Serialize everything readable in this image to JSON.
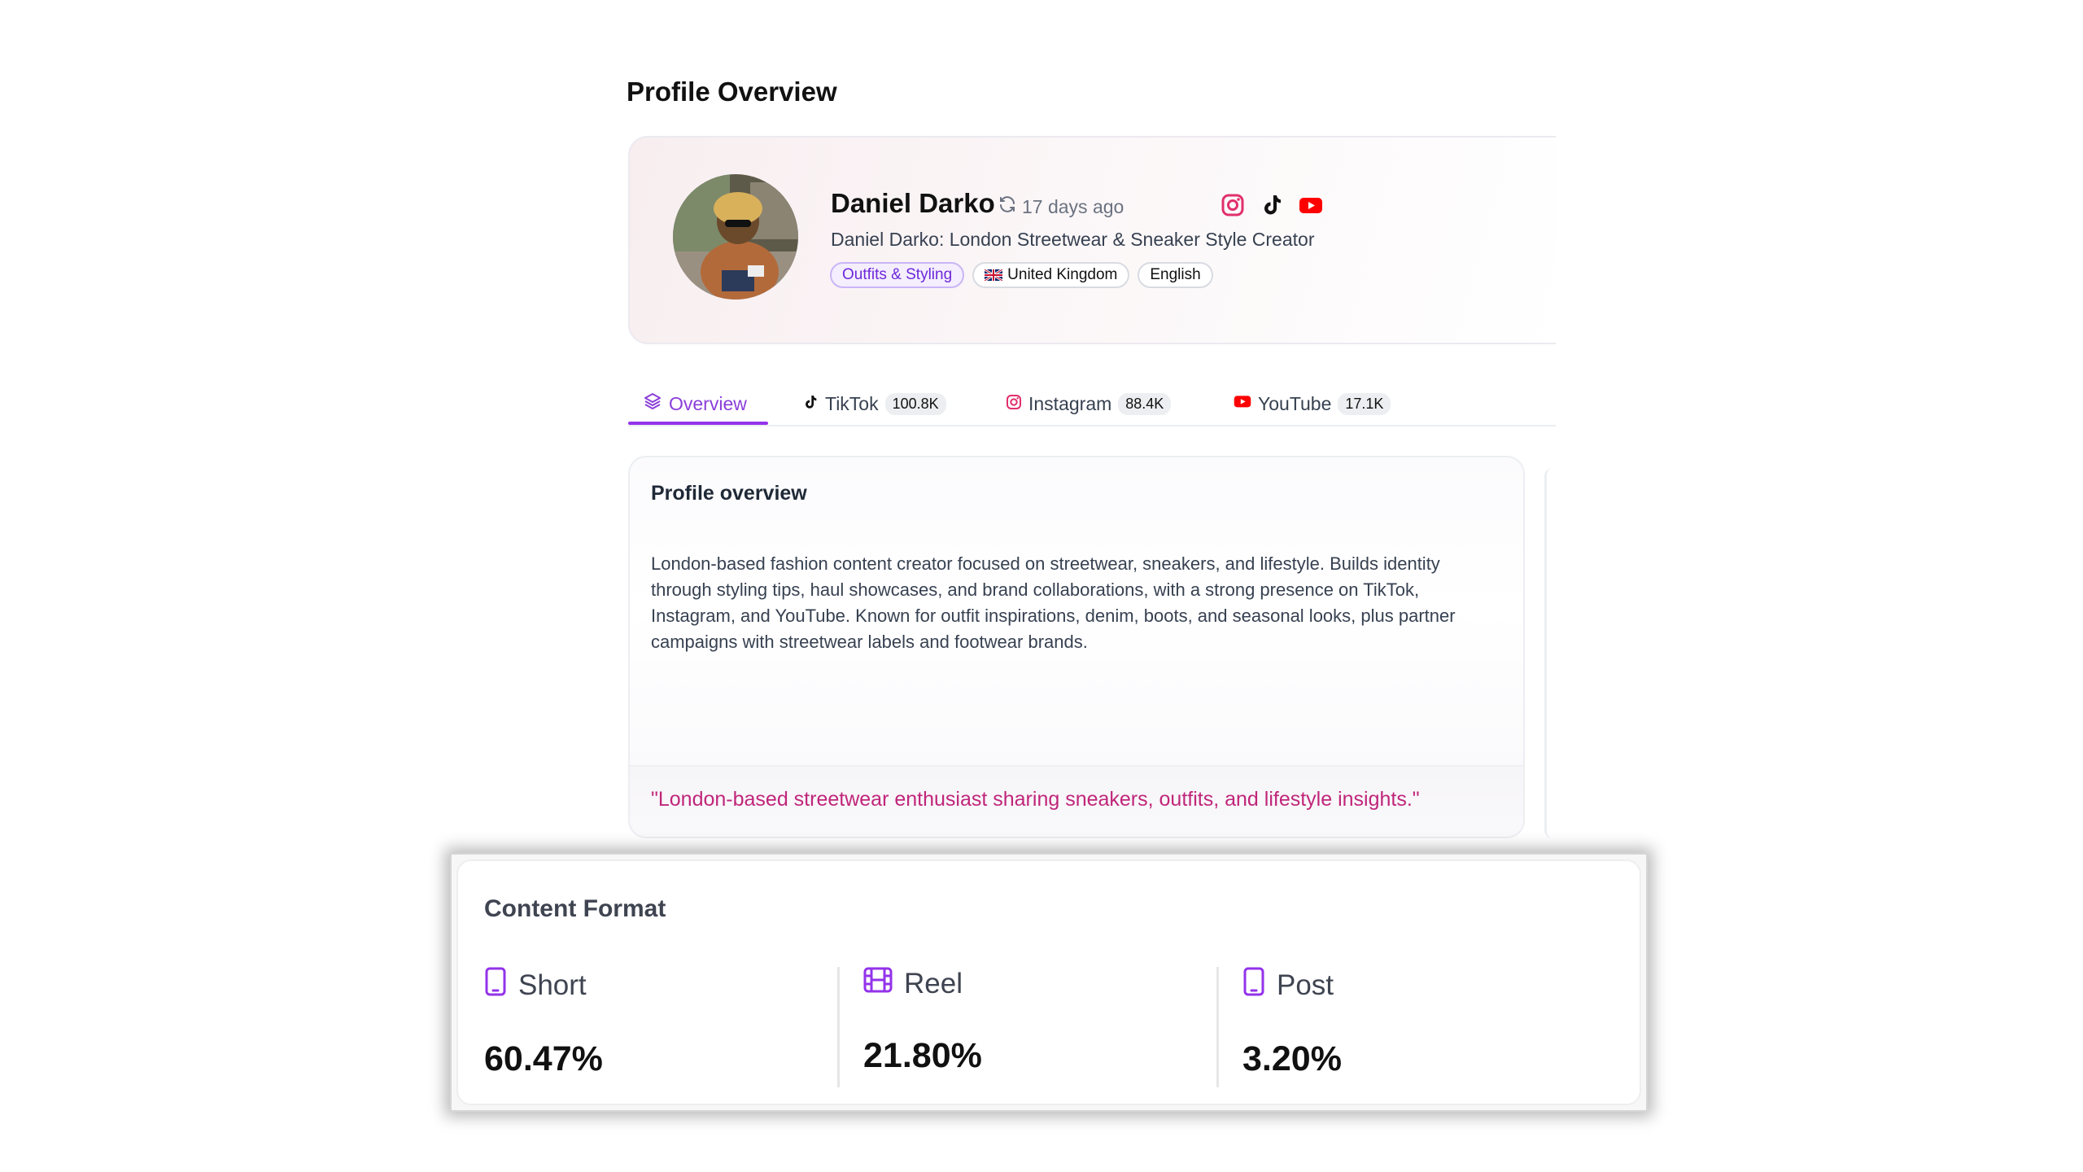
{
  "page": {
    "title": "Profile Overview"
  },
  "profile": {
    "name": "Daniel Darko",
    "last_synced": "17 days ago",
    "bio": "Daniel Darko: London Streetwear & Sneaker Style Creator",
    "platform_icons": [
      "instagram-icon",
      "tiktok-icon",
      "youtube-icon"
    ],
    "chips": {
      "category": "Outfits & Styling",
      "country": "United Kingdom",
      "language": "English"
    }
  },
  "tabs": [
    {
      "label": "Overview",
      "icon": "layers-icon",
      "active": true
    },
    {
      "label": "TikTok",
      "icon": "tiktok-icon",
      "count": "100.8K"
    },
    {
      "label": "Instagram",
      "icon": "instagram-icon",
      "count": "88.4K"
    },
    {
      "label": "YouTube",
      "icon": "youtube-icon",
      "count": "17.1K"
    }
  ],
  "overview": {
    "title": "Profile overview",
    "text": "London-based fashion content creator focused on streetwear, sneakers, and lifestyle. Builds identity through styling tips, haul showcases, and brand collaborations, with a strong presence on TikTok, Instagram, and YouTube. Known for outfit inspirations, denim, boots, and seasonal looks, plus partner campaigns with streetwear labels and footwear brands.",
    "tagline": "\"London-based streetwear enthusiast sharing sneakers, outfits, and lifestyle insights.\""
  },
  "content_format": {
    "title": "Content Format",
    "items": [
      {
        "label": "Short",
        "value": "60.47%",
        "icon": "phone-icon"
      },
      {
        "label": "Reel",
        "value": "21.80%",
        "icon": "film-icon"
      },
      {
        "label": "Post",
        "value": "3.20%",
        "icon": "phone-icon"
      }
    ]
  },
  "colors": {
    "accent": "#9333ea",
    "tagline": "#c0267a",
    "instagram": "#e1306c",
    "youtube": "#ff0000"
  }
}
